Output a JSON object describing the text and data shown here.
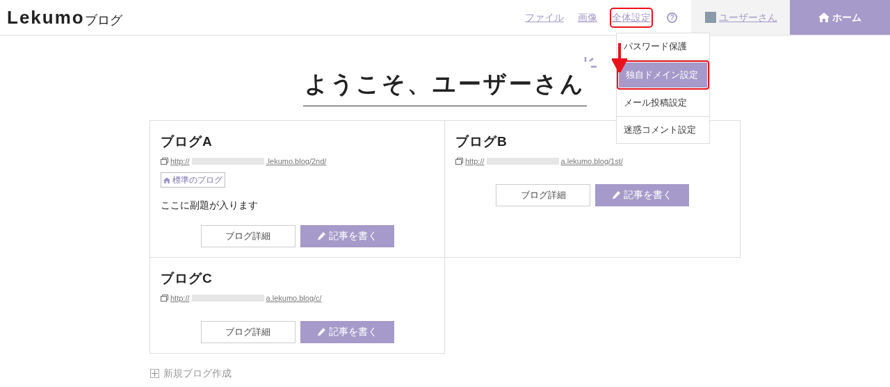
{
  "header": {
    "logo": "Lekumo",
    "logo_suffix": "ブログ",
    "nav": [
      {
        "label": "ファイル",
        "highlighted": false
      },
      {
        "label": "画像",
        "highlighted": false
      },
      {
        "label": "全体設定",
        "highlighted": true
      }
    ],
    "help": "?",
    "user": "ユーザーさん",
    "home": "ホーム"
  },
  "dropdown": [
    {
      "label": "パスワード保護",
      "selected": false
    },
    {
      "label": "独自ドメイン設定",
      "selected": true
    },
    {
      "label": "メール投稿設定",
      "selected": false
    },
    {
      "label": "迷惑コメント設定",
      "selected": false
    }
  ],
  "title": "ようこそ、ユーザーさん",
  "blogs": [
    {
      "name": "ブログA",
      "url_start": "http://",
      "url_end": ".lekumo.blog/2nd/",
      "badge": "標準のブログ",
      "subtitle": "ここに副題が入ります",
      "details": "ブログ詳細",
      "write": "記事を書く"
    },
    {
      "name": "ブログB",
      "url_start": "http://",
      "url_end": "a.lekumo.blog/1st/",
      "details": "ブログ詳細",
      "write": "記事を書く"
    },
    {
      "name": "ブログC",
      "url_start": "http://",
      "url_end": "a.lekumo.blog/c/",
      "details": "ブログ詳細",
      "write": "記事を書く"
    }
  ],
  "new_blog": "新規ブログ作成"
}
